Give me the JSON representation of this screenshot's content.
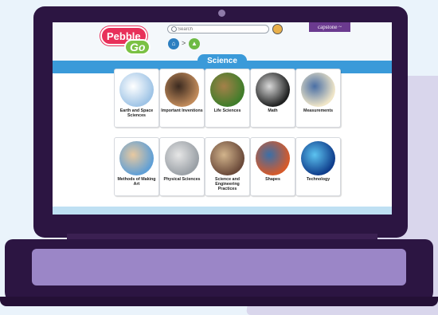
{
  "header": {
    "logo_top": "Pebble",
    "logo_bottom": "Go",
    "search_placeholder": "Search",
    "capstone_label": "capstone ~"
  },
  "breadcrumb": {
    "separator": ">"
  },
  "section": {
    "title": "Science"
  },
  "topics": [
    {
      "label": "Earth and Space Sciences",
      "colors": [
        "#9fc4e6",
        "#ffffff"
      ]
    },
    {
      "label": "Important Inventions",
      "colors": [
        "#c08a5a",
        "#3b2a20"
      ]
    },
    {
      "label": "Life Sciences",
      "colors": [
        "#3f7d2a",
        "#a58049"
      ]
    },
    {
      "label": "Math",
      "colors": [
        "#1f2020",
        "#d9d9d9"
      ]
    },
    {
      "label": "Measurements",
      "colors": [
        "#f0e6c8",
        "#4a6fa5"
      ]
    },
    {
      "label": "Methods of Making Art",
      "colors": [
        "#5f9fd6",
        "#e8c9a0"
      ]
    },
    {
      "label": "Physical Sciences",
      "colors": [
        "#9aa0a6",
        "#e6e6e6"
      ]
    },
    {
      "label": "Science and Engineering Practices",
      "colors": [
        "#6b4a3a",
        "#d2b48c"
      ]
    },
    {
      "label": "Shapes",
      "colors": [
        "#d65a2a",
        "#3a6fa8"
      ]
    },
    {
      "label": "Technology",
      "colors": [
        "#0f3d8c",
        "#5cc3f0"
      ]
    }
  ]
}
